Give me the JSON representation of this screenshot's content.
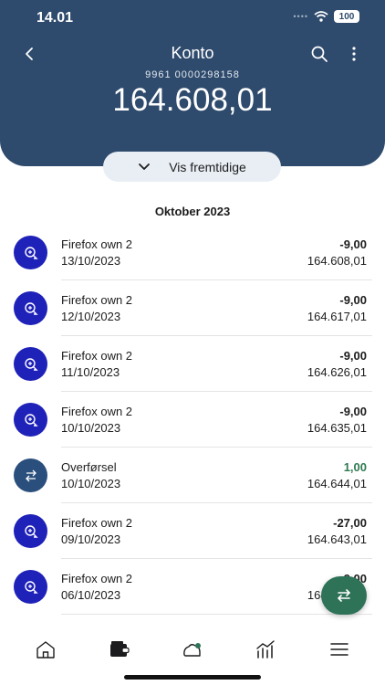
{
  "status_bar": {
    "time": "14.01",
    "signal": "••••",
    "battery": "100"
  },
  "header": {
    "title": "Konto",
    "account_number": "9961 0000298158",
    "balance": "164.608,01"
  },
  "future_button": {
    "label": "Vis fremtidige"
  },
  "month_heading": "Oktober 2023",
  "transactions": [
    {
      "name": "Firefox own 2",
      "date": "13/10/2023",
      "amount": "-9,00",
      "saldo": "164.608,01",
      "icon": "payment-icon"
    },
    {
      "name": "Firefox own 2",
      "date": "12/10/2023",
      "amount": "-9,00",
      "saldo": "164.617,01",
      "icon": "payment-icon"
    },
    {
      "name": "Firefox own 2",
      "date": "11/10/2023",
      "amount": "-9,00",
      "saldo": "164.626,01",
      "icon": "payment-icon"
    },
    {
      "name": "Firefox own 2",
      "date": "10/10/2023",
      "amount": "-9,00",
      "saldo": "164.635,01",
      "icon": "payment-icon"
    },
    {
      "name": "Overførsel",
      "date": "10/10/2023",
      "amount": "1,00",
      "saldo": "164.644,01",
      "icon": "transfer-icon"
    },
    {
      "name": "Firefox own 2",
      "date": "09/10/2023",
      "amount": "-27,00",
      "saldo": "164.643,01",
      "icon": "payment-icon"
    },
    {
      "name": "Firefox own 2",
      "date": "06/10/2023",
      "amount": "-9,00",
      "saldo": "164.652,01",
      "icon": "payment-icon"
    }
  ],
  "tabbar": {
    "items": [
      "home-icon",
      "wallet-icon",
      "piggy-bank-icon",
      "chart-icon",
      "menu-icon"
    ]
  },
  "colors": {
    "header": "#2e4a6c",
    "payment_icon": "#1f22b8",
    "transfer_icon": "#2b4f7d",
    "positive": "#2f7a52",
    "fab": "#2e7258"
  }
}
